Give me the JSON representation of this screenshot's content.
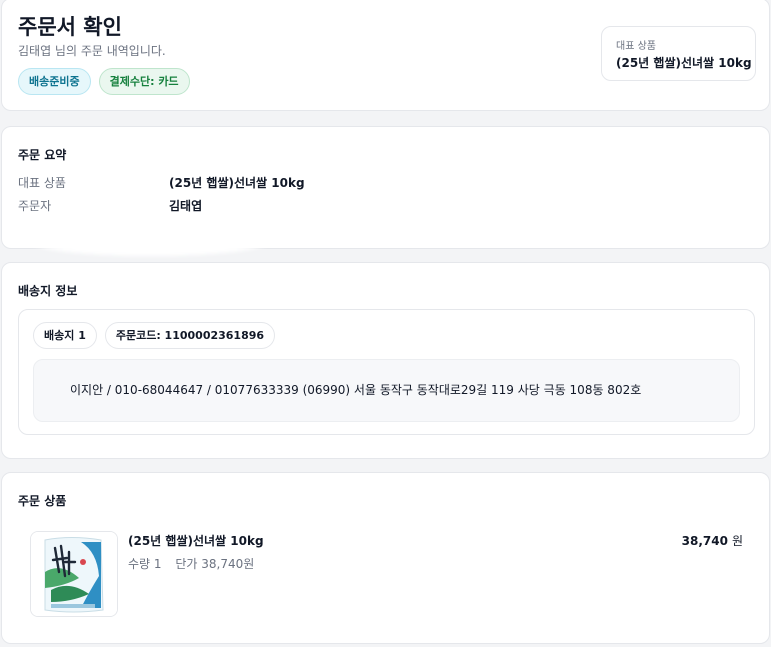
{
  "header": {
    "title": "주문서 확인",
    "subtitle": "김태엽 님의 주문 내역입니다.",
    "status_badge": "배송준비중",
    "payment_badge": "결제수단: 카드",
    "representative": {
      "label": "대표 상품",
      "value": "(25년 햅쌀)선녀쌀 10kg"
    }
  },
  "summary": {
    "title": "주문 요약",
    "rows": [
      {
        "key": "대표 상품",
        "value": "(25년 햅쌀)선녀쌀 10kg"
      },
      {
        "key": "주문자",
        "value": "김태엽"
      }
    ]
  },
  "shipping": {
    "title": "배송지 정보",
    "destination_chip": "배송지 1",
    "order_code_chip": "주문코드: 1100002361896",
    "address": "이지안 / 010-68044647 / 01077633339 (06990) 서울 동작구 동작대로29길 119 사당 극동 108동 802호"
  },
  "items": {
    "title": "주문 상품",
    "products": [
      {
        "name": "(25년 햅쌀)선녀쌀 10kg",
        "quantity": "수량 1",
        "unit_price": "단가 38,740원",
        "price": "38,740",
        "currency": "원",
        "thumbnail": "rice-bag-image"
      }
    ]
  },
  "colors": {
    "status_badge_bg": "#e6f7fb",
    "status_badge_text": "#0e7490",
    "payment_badge_bg": "#eaf7ef",
    "payment_badge_text": "#15803d"
  }
}
